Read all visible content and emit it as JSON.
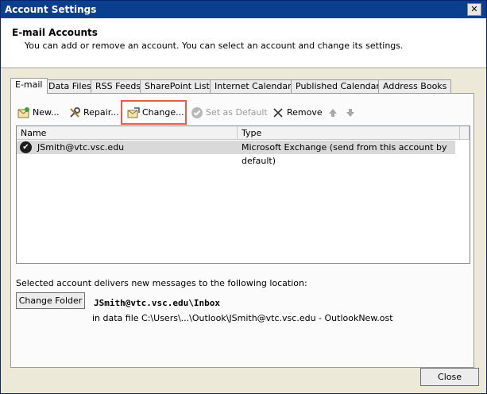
{
  "window": {
    "title": "Account Settings",
    "close_glyph": "✕"
  },
  "header": {
    "title": "E-mail Accounts",
    "subtitle": "You can add or remove an account. You can select an account and change its settings."
  },
  "tabs": [
    {
      "label": "E-mail",
      "active": true
    },
    {
      "label": "Data Files"
    },
    {
      "label": "RSS Feeds"
    },
    {
      "label": "SharePoint Lists"
    },
    {
      "label": "Internet Calendars"
    },
    {
      "label": "Published Calendars"
    },
    {
      "label": "Address Books"
    }
  ],
  "toolbar": {
    "new_label": "New...",
    "repair_label": "Repair...",
    "change_label": "Change...",
    "set_default_label": "Set as Default",
    "remove_label": "Remove",
    "move_up_icon": "up-arrow-icon",
    "move_down_icon": "down-arrow-icon"
  },
  "accounts_table": {
    "columns": [
      "Name",
      "Type"
    ],
    "rows": [
      {
        "name": "JSmith@vtc.vsc.edu",
        "type": "Microsoft Exchange (send from this account by default)",
        "default": true
      }
    ]
  },
  "delivery": {
    "label": "Selected account delivers new messages to the following location:",
    "change_folder_label": "Change Folder",
    "folder": "JSmith@vtc.vsc.edu\\Inbox",
    "data_file": "in data file C:\\Users\\...\\Outlook\\JSmith@vtc.vsc.edu - OutlookNew.ost"
  },
  "footer": {
    "close_label": "Close"
  },
  "colors": {
    "highlight": "#e25f4a",
    "titlebar": "#0a3e8f"
  }
}
